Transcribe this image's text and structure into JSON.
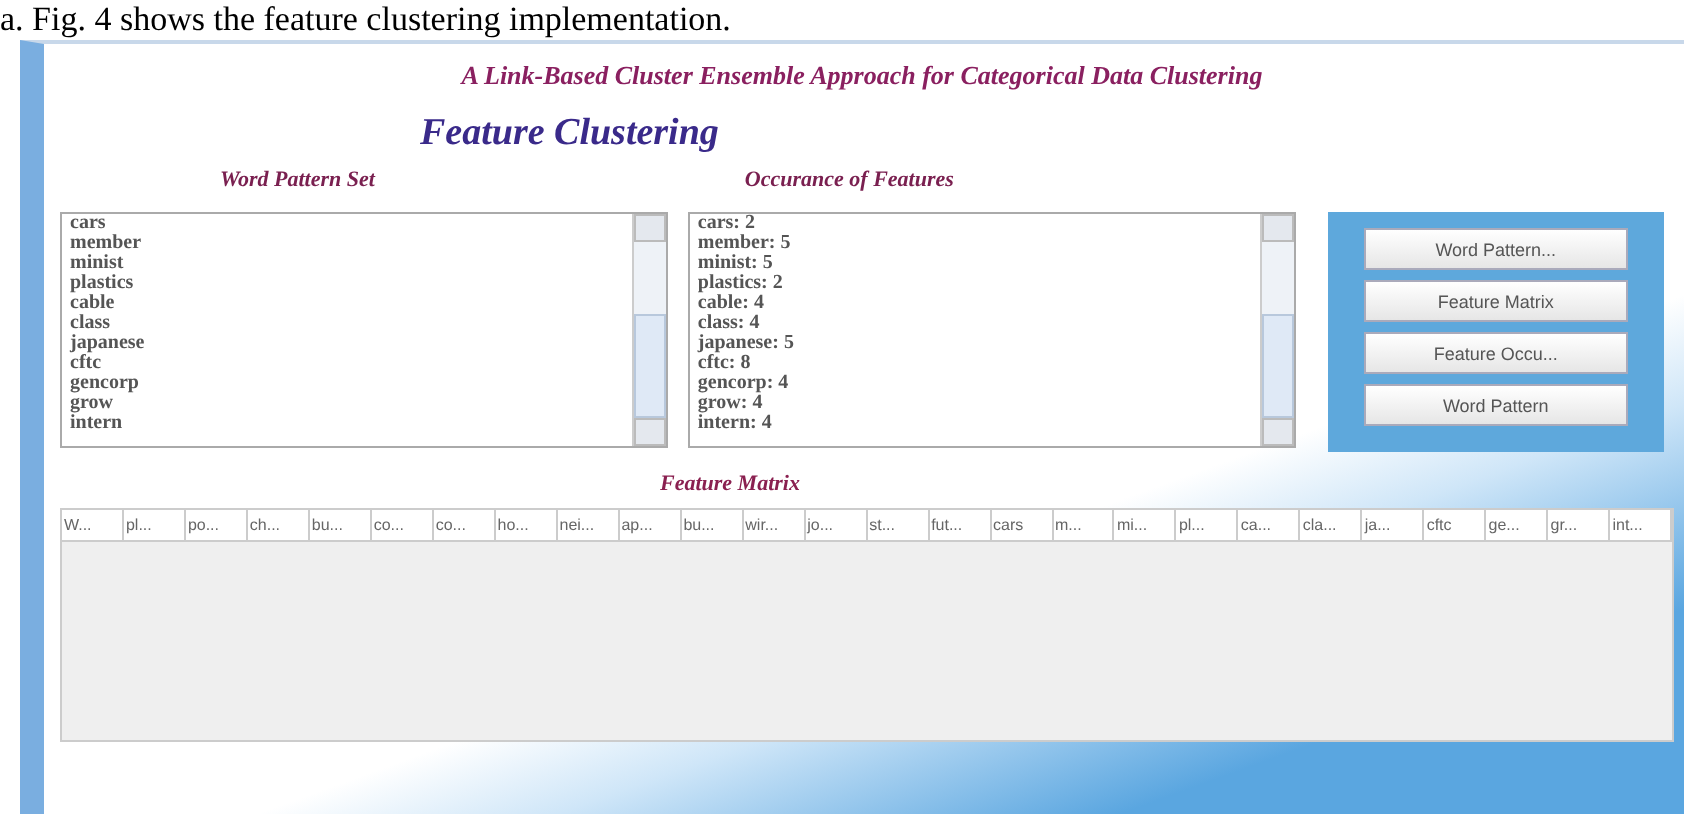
{
  "caption": "a. Fig. 4 shows the feature clustering implementation.",
  "window": {
    "title": "A Link-Based Cluster Ensemble Approach for Categorical Data Clustering",
    "heading": "Feature Clustering"
  },
  "word_pattern_set": {
    "label": "Word Pattern Set",
    "items": [
      "cars",
      "member",
      "minist",
      "plastics",
      "cable",
      "class",
      "japanese",
      "cftc",
      "gencorp",
      "grow",
      "intern"
    ]
  },
  "occurance_of_features": {
    "label": "Occurance of Features",
    "items": [
      "cars: 2",
      "member: 5",
      "minist: 5",
      "plastics: 2",
      "cable: 4",
      "class: 4",
      "japanese: 5",
      "cftc: 8",
      "gencorp: 4",
      "grow: 4",
      "intern: 4"
    ]
  },
  "buttons": [
    "Word Pattern...",
    "Feature Matrix",
    "Feature Occu...",
    "Word Pattern"
  ],
  "feature_matrix": {
    "label": "Feature Matrix",
    "columns": [
      "W...",
      "pl...",
      "po...",
      "ch...",
      "bu...",
      "co...",
      "co...",
      "ho...",
      "nei...",
      "ap...",
      "bu...",
      "wir...",
      "jo...",
      "st...",
      "fut...",
      "cars",
      "m...",
      "mi...",
      "pl...",
      "ca...",
      "cla...",
      "ja...",
      "cftc",
      "ge...",
      "gr...",
      "int..."
    ]
  }
}
